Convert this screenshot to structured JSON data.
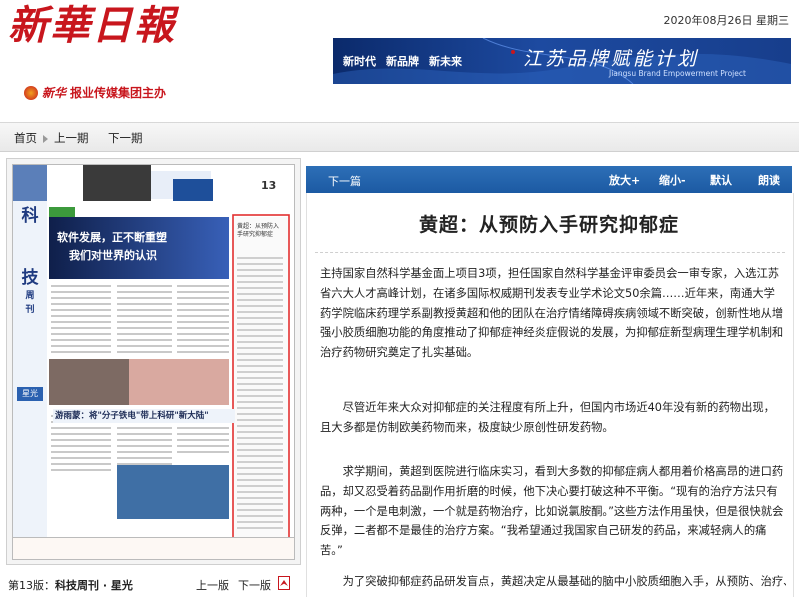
{
  "header": {
    "masthead": "新華日報",
    "sponsor_brand": "新华",
    "sponsor_text": "报业传媒集团主办",
    "date": "2020年08月26日 星期三"
  },
  "banner": {
    "tags": [
      "新时代",
      "新品牌",
      "新未来"
    ],
    "title": "江苏品牌赋能计划",
    "subtitle": "Jiangsu Brand Empowerment Project",
    "colors": {
      "bg": "#173e8c",
      "accent": "#c8161d"
    }
  },
  "nav": {
    "home": "首页",
    "prev": "上一期",
    "next": "下一期"
  },
  "page": {
    "label_prefix": "第13版：",
    "label_name": "科技周刊 · 星光",
    "prev": "上一版",
    "next": "下一版",
    "pdf_icon": "pdf-icon"
  },
  "thumbnail": {
    "section_chars": [
      "科",
      "技",
      "周",
      "刊"
    ],
    "page_number": "13",
    "headline1": "软件发展，正不断重塑",
    "headline2": "我们对世界的认识",
    "headline3": "游雨蒙：将\"分子铁电\"带上科研\"新大陆\"",
    "badge": "星光",
    "box_title": "黄超：从预防入手研究抑郁症"
  },
  "toolbar": {
    "next_article": "下一篇",
    "zoom_in": "放大+",
    "zoom_out": "缩小-",
    "default": "默认",
    "read": "朗读"
  },
  "article": {
    "title": "黄超：从预防入手研究抑郁症",
    "paragraphs": [
      "主持国家自然科学基金面上项目3项，担任国家自然科学基金评审委员会一审专家，入选江苏省六大人才高峰计划，在诸多国际权威期刊发表专业学术论文50余篇……近年来，南通大学药学院临床药理学系副教授黄超和他的团队在治疗情绪障碍疾病领域不断突破，创新性地从增强小胶质细胞功能的角度推动了抑郁症神经炎症假说的发展，为抑郁症新型病理生理学机制和治疗药物研究奠定了扎实基础。",
      "尽管近年来大众对抑郁症的关注程度有所上升，但国内市场近40年没有新的药物出现，且大多都是仿制欧美药物而来，极度缺少原创性研发药物。",
      "求学期间，黄超到医院进行临床实习，看到大多数的抑郁症病人都用着价格高昂的进口药品，却又忍受着药品副作用折磨的时候，他下决心要打破这种不平衡。“现有的治疗方法只有两种，一个是电刺激，一个就是药物治疗，比如说氯胺酮。”这些方法作用虽快，但是很快就会反弹，二者都不是最佳的治疗方案。“我希望通过我国家自己研发的药品，来减轻病人的痛苦。”",
      "为了突破抑郁症药品研发盲点，黄超决定从最基础的脑中小胶质细胞入手，从预防、治疗、过程"
    ]
  }
}
